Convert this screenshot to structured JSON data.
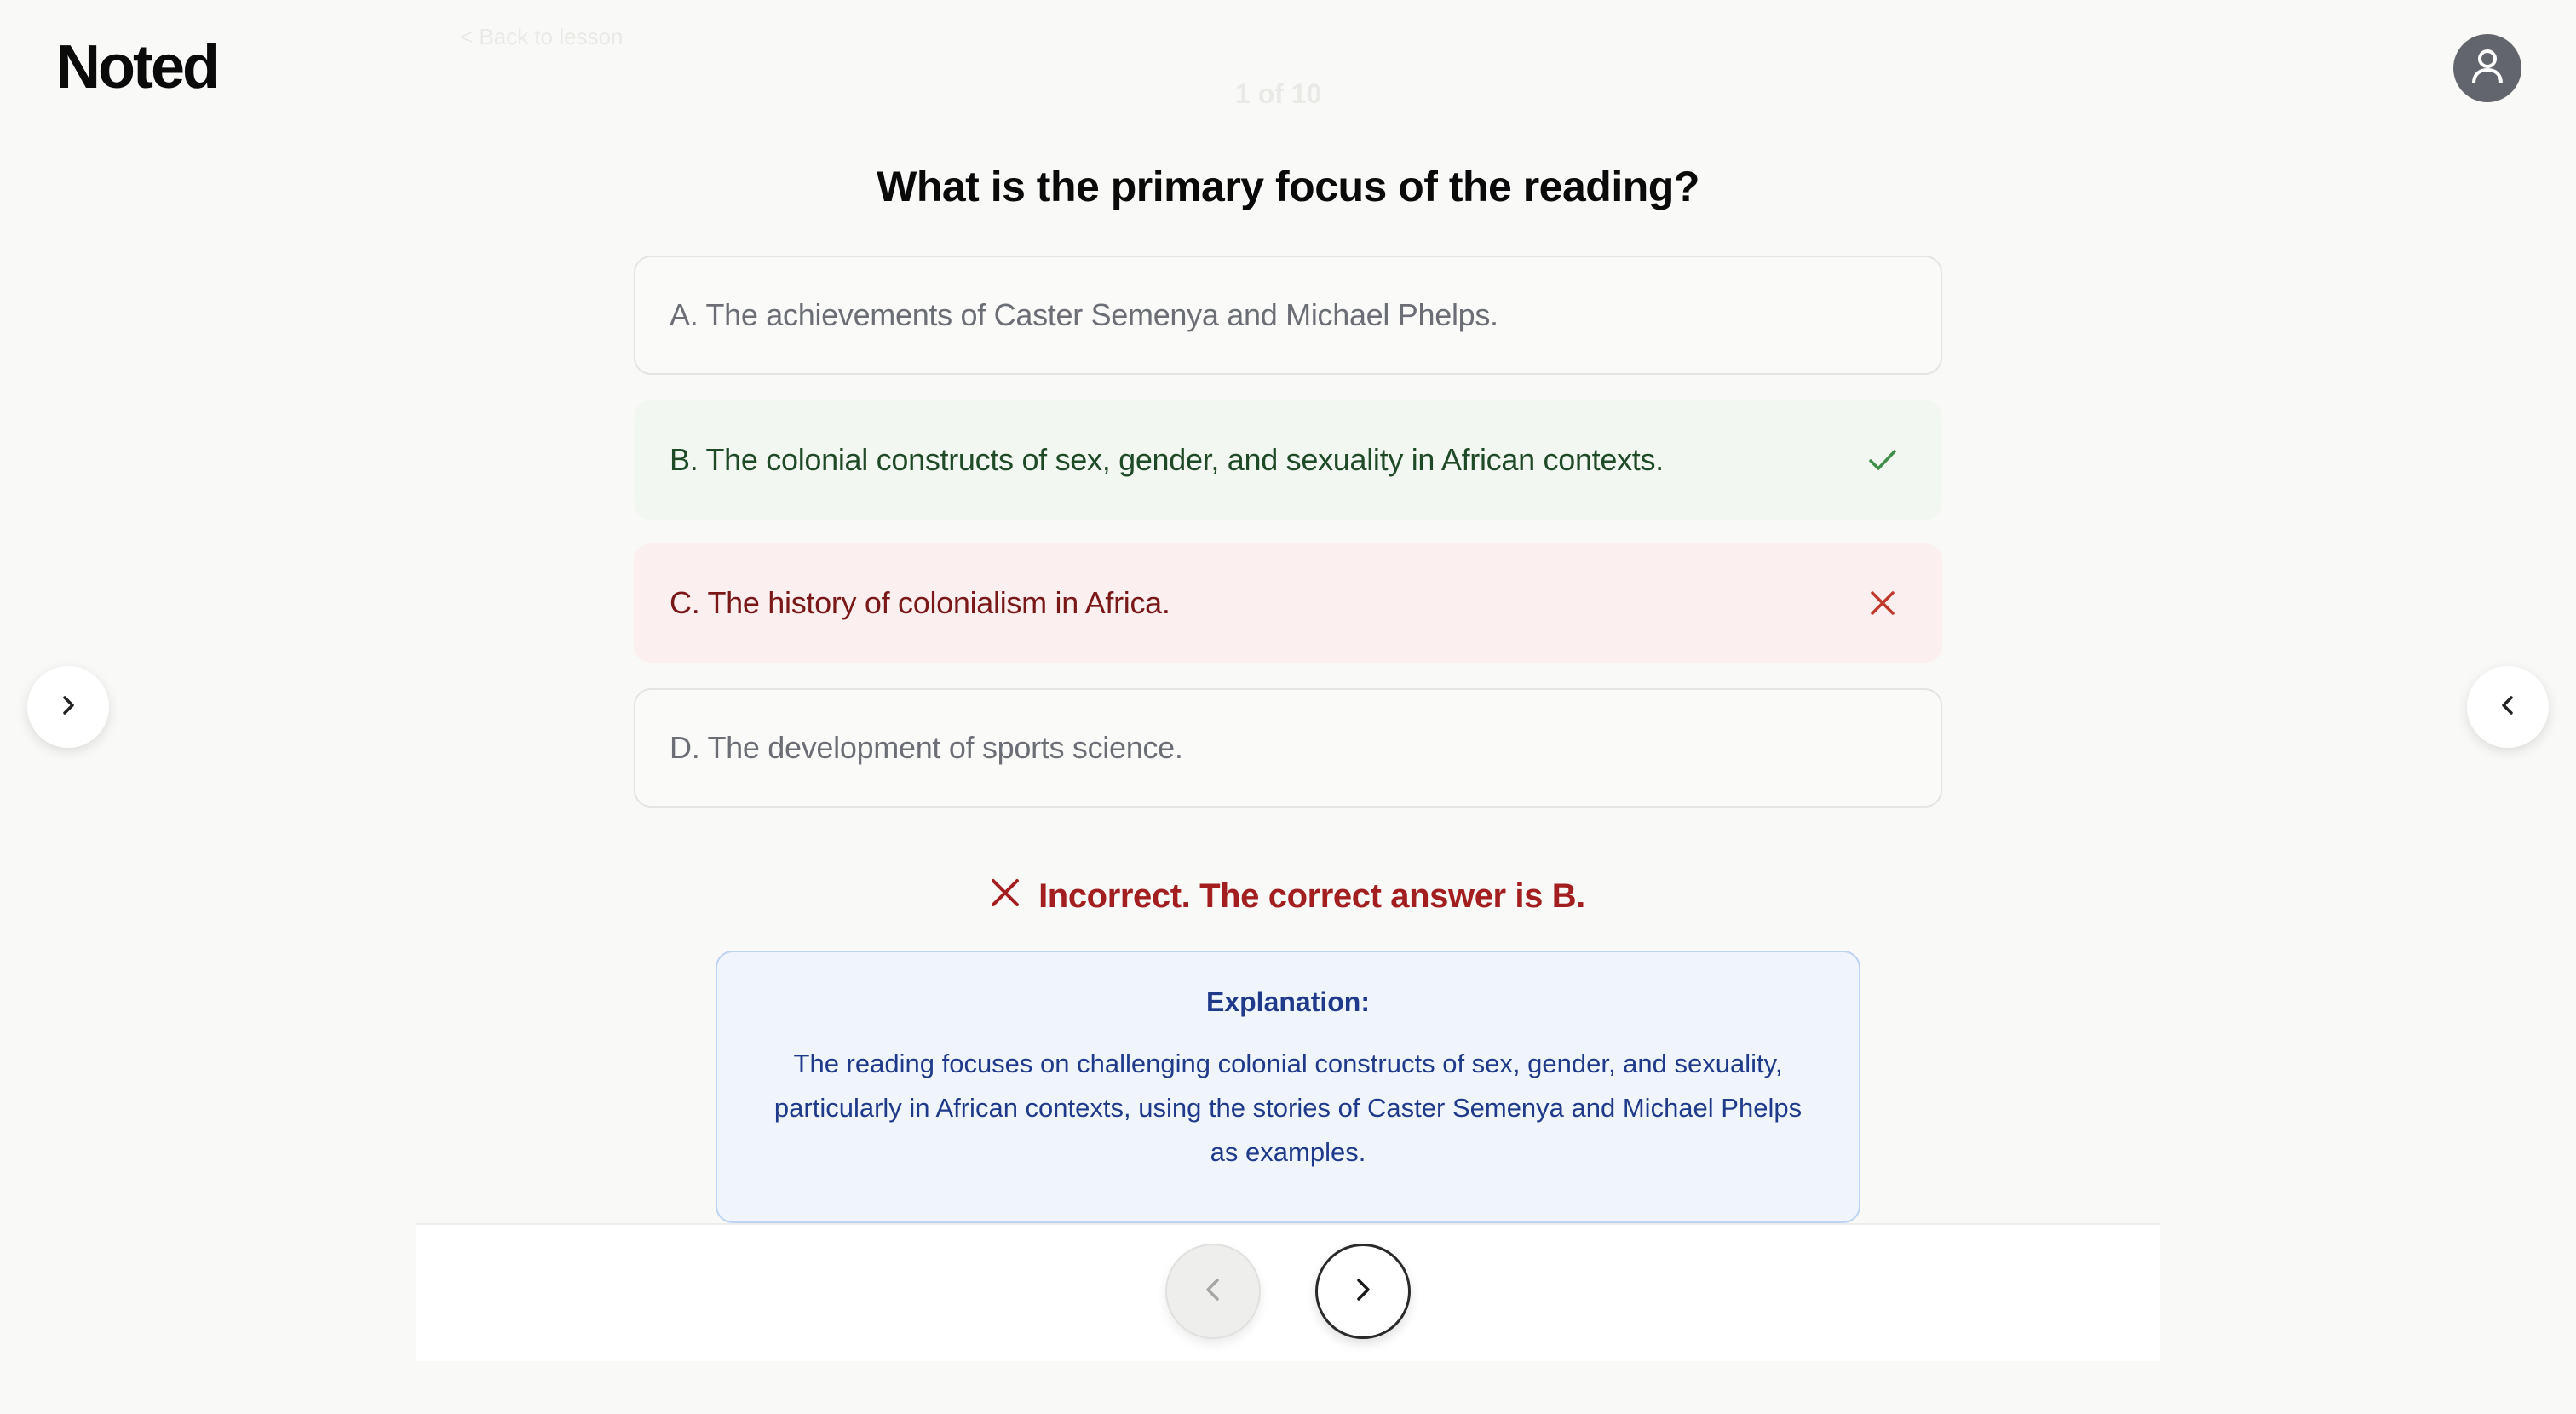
{
  "app": {
    "logo": "Noted"
  },
  "header": {
    "back_label": "< Back to lesson",
    "progress": "1 of 10"
  },
  "quiz": {
    "question": "What is the primary focus of the reading?",
    "options": [
      {
        "label": "A. The achievements of Caster Semenya and Michael Phelps.",
        "state": "neutral"
      },
      {
        "label": "B. The colonial constructs of sex, gender, and sexuality in African contexts.",
        "state": "correct"
      },
      {
        "label": "C. The history of colonialism in Africa.",
        "state": "incorrect"
      },
      {
        "label": "D. The development of sports science.",
        "state": "neutral"
      }
    ],
    "feedback": "Incorrect. The correct answer is B.",
    "explanation_title": "Explanation:",
    "explanation_body": "The reading focuses on challenging colonial constructs of sex, gender, and sexuality, particularly in African contexts, using the stories of Caster Semenya and Michael Phelps as examples."
  },
  "icons": {
    "avatar": "user-icon",
    "correct": "check-icon",
    "incorrect": "x-icon",
    "left_side": "chevron-right-icon",
    "right_side": "chevron-left-icon",
    "prev": "chevron-left-icon",
    "next": "chevron-right-icon"
  },
  "colors": {
    "correct": "#3f8f4a",
    "incorrect": "#a31f1f",
    "explanation_text": "#1f3a8a"
  }
}
